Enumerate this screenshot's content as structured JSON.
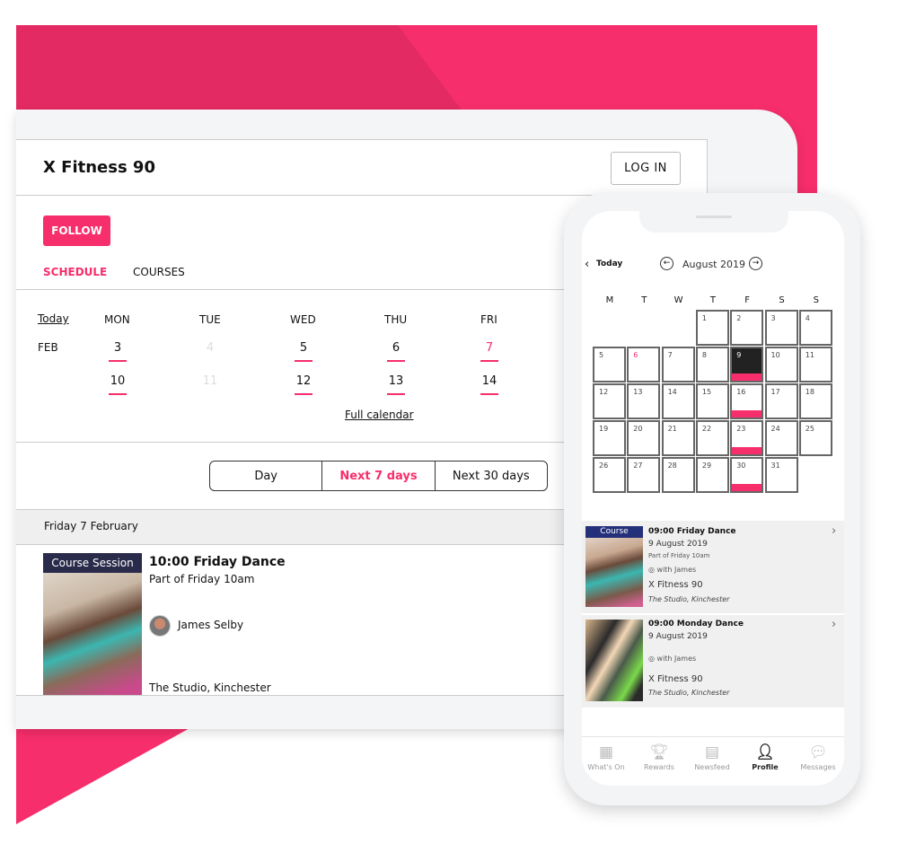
{
  "tablet": {
    "title": "X Fitness 90",
    "login": "LOG IN",
    "follow": "FOLLOW",
    "tabs": [
      {
        "label": "SCHEDULE",
        "active": true
      },
      {
        "label": "COURSES",
        "active": false
      }
    ],
    "today": "Today",
    "month": "FEB",
    "days": [
      "MON",
      "TUE",
      "WED",
      "THU",
      "FRI"
    ],
    "week1": [
      "3",
      "4",
      "5",
      "6",
      "7"
    ],
    "week2": [
      "10",
      "11",
      "12",
      "13",
      "14"
    ],
    "full_calendar": "Full calendar",
    "range": [
      "Day",
      "Next 7 days",
      "Next 30 days"
    ],
    "range_selected": "Next 7 days",
    "section": "Friday 7 February",
    "event": {
      "badge": "Course Session",
      "title": "10:00 Friday Dance",
      "subtitle": "Part of Friday 10am",
      "instructor": "James Selby",
      "location": "The Studio, Kinchester"
    }
  },
  "phone": {
    "back": "Today",
    "month": "August 2019",
    "weekdays": [
      "M",
      "T",
      "W",
      "T",
      "F",
      "S",
      "S"
    ],
    "days": [
      "1",
      "2",
      "3",
      "4",
      "5",
      "6",
      "7",
      "8",
      "9",
      "10",
      "11",
      "12",
      "13",
      "14",
      "15",
      "16",
      "17",
      "18",
      "19",
      "20",
      "21",
      "22",
      "23",
      "24",
      "25",
      "26",
      "27",
      "28",
      "29",
      "30",
      "31"
    ],
    "selected_day": "9",
    "highlight_day": "6",
    "event_days": [
      "9",
      "16",
      "23",
      "30"
    ],
    "events": [
      {
        "badge": "Course",
        "title": "09:00 Friday Dance",
        "date": "9 August 2019",
        "part": "Part of Friday 10am",
        "with": "with James",
        "org": "X Fitness 90",
        "location": "The Studio, Kinchester"
      },
      {
        "badge": "",
        "title": "09:00 Monday Dance",
        "date": "9 August 2019",
        "part": "",
        "with": "with James",
        "org": "X Fitness 90",
        "location": "The Studio, Kinchester"
      }
    ],
    "tabs": [
      {
        "label": "What's On",
        "icon": "calendar-icon"
      },
      {
        "label": "Rewards",
        "icon": "trophy-icon"
      },
      {
        "label": "Newsfeed",
        "icon": "newsfeed-icon"
      },
      {
        "label": "Profile",
        "icon": "profile-icon",
        "active": true
      },
      {
        "label": "Messages",
        "icon": "chat-bubble-icon"
      }
    ]
  },
  "colors": {
    "accent": "#f72e6c",
    "badge": "#2a2a4a"
  }
}
